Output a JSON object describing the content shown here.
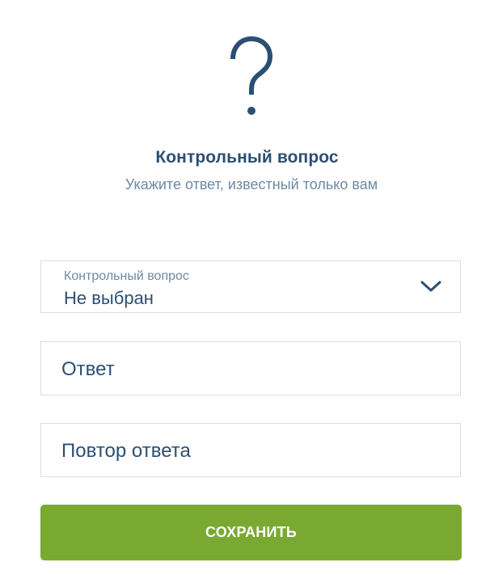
{
  "header": {
    "icon": "question-mark-icon",
    "title": "Контрольный вопрос",
    "subtitle": "Укажите ответ, известный только вам"
  },
  "form": {
    "question_select": {
      "label": "Контрольный вопрос",
      "value": "Не выбран",
      "icon": "chevron-down-icon"
    },
    "answer": {
      "placeholder": "Ответ",
      "value": ""
    },
    "repeat_answer": {
      "placeholder": "Повтор ответа",
      "value": ""
    },
    "save_label": "СОХРАНИТЬ"
  },
  "colors": {
    "primary_text": "#2b4f72",
    "secondary_text": "#6f8aa3",
    "button": "#7aa932",
    "border": "#d9dde2"
  }
}
